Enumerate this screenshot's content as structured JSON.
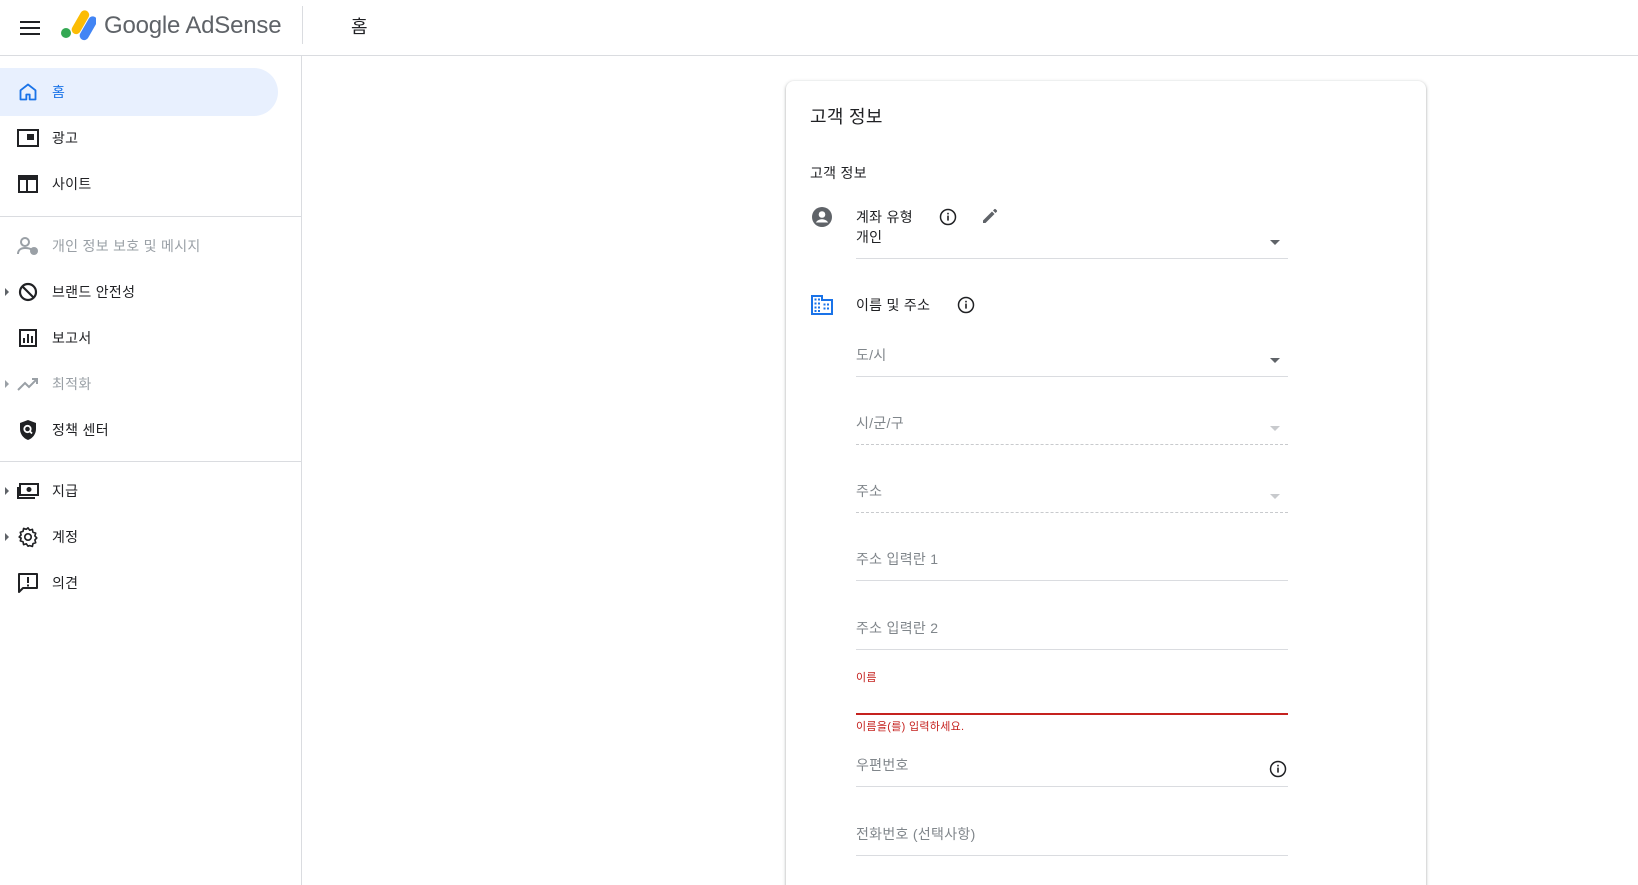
{
  "app": {
    "brand": "Google AdSense",
    "breadcrumb": "홈"
  },
  "sidebar": {
    "items": [
      {
        "label": "홈",
        "icon": "home-icon",
        "state": "active"
      },
      {
        "label": "광고",
        "icon": "ads-icon",
        "state": "normal"
      },
      {
        "label": "사이트",
        "icon": "sites-icon",
        "state": "normal"
      },
      {
        "label": "개인 정보 보호 및 메시지",
        "icon": "privacy-icon",
        "state": "disabled"
      },
      {
        "label": "브랜드 안전성",
        "icon": "block-icon",
        "state": "normal",
        "expandable": true
      },
      {
        "label": "보고서",
        "icon": "reports-icon",
        "state": "normal"
      },
      {
        "label": "최적화",
        "icon": "trending-icon",
        "state": "disabled",
        "expandable": true
      },
      {
        "label": "정책 센터",
        "icon": "policy-icon",
        "state": "normal"
      },
      {
        "label": "지급",
        "icon": "payments-icon",
        "state": "normal",
        "expandable": true
      },
      {
        "label": "계정",
        "icon": "gear-icon",
        "state": "normal",
        "expandable": true
      },
      {
        "label": "의견",
        "icon": "feedback-icon",
        "state": "normal"
      }
    ]
  },
  "card": {
    "title": "고객 정보",
    "section_title": "고객 정보",
    "account_type": {
      "label": "계좌 유형",
      "value": "개인"
    },
    "name_address": {
      "label": "이름 및 주소",
      "fields": {
        "province": "도/시",
        "city": "시/군/구",
        "address": "주소",
        "address_line1": "주소 입력란 1",
        "address_line2": "주소 입력란 2",
        "name_label": "이름",
        "name_error": "이름을(를) 입력하세요.",
        "postal_code": "우편번호",
        "phone": "전화번호 (선택사항)"
      }
    }
  },
  "colors": {
    "accent": "#1a73e8",
    "active_bg": "#e8f0fe",
    "error": "#c5221f",
    "divider": "#dadce0"
  }
}
